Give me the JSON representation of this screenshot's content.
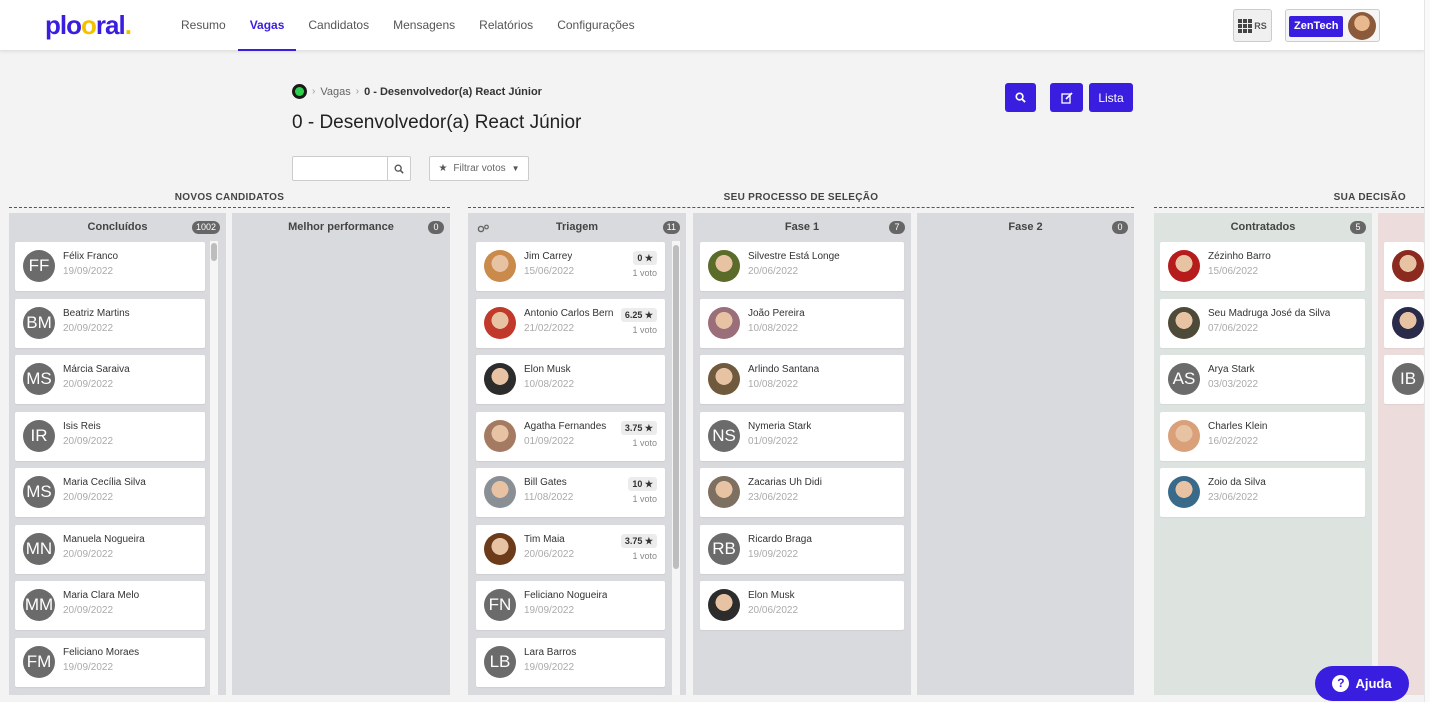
{
  "app": {
    "logo": "plooral",
    "colors": {
      "brand": "#3a1ee0",
      "logo_dot": "#f2c200"
    }
  },
  "nav": {
    "items": [
      "Resumo",
      "Vagas",
      "Candidatos",
      "Mensagens",
      "Relatórios",
      "Configurações"
    ],
    "active": "Vagas"
  },
  "header_right": {
    "apps_label": "RS",
    "company": "ZenTech"
  },
  "breadcrumb": {
    "items": [
      "Vagas",
      "0 - Desenvolvedor(a) React Júnior"
    ]
  },
  "page_title": "0 - Desenvolvedor(a) React Júnior",
  "actions": {
    "search_icon": "search-icon",
    "edit_icon": "edit-icon",
    "list_label": "Lista"
  },
  "filters": {
    "search_value": "",
    "search_placeholder": "",
    "filter_votes_label": "Filtrar votos"
  },
  "sections": {
    "novos": "NOVOS CANDIDATOS",
    "processo": "SEU PROCESSO DE SELEÇÃO",
    "decisao": "SUA DECISÃO"
  },
  "columns": [
    {
      "title": "Concluídos",
      "count": "1002",
      "cards": [
        {
          "name": "Félix Franco",
          "date": "19/09/2022",
          "initials": "FF"
        },
        {
          "name": "Beatriz Martins",
          "date": "20/09/2022",
          "initials": "BM"
        },
        {
          "name": "Márcia Saraiva",
          "date": "20/09/2022",
          "initials": "MS"
        },
        {
          "name": "Isis Reis",
          "date": "20/09/2022",
          "initials": "IR"
        },
        {
          "name": "Maria Cecília Silva",
          "date": "20/09/2022",
          "initials": "MS"
        },
        {
          "name": "Manuela Nogueira",
          "date": "20/09/2022",
          "initials": "MN"
        },
        {
          "name": "Maria Clara Melo",
          "date": "20/09/2022",
          "initials": "MM"
        },
        {
          "name": "Feliciano Moraes",
          "date": "19/09/2022",
          "initials": "FM"
        }
      ]
    },
    {
      "title": "Melhor performance",
      "count": "0",
      "cards": []
    },
    {
      "title": "Triagem",
      "count": "11",
      "cards": [
        {
          "name": "Jim Carrey",
          "date": "15/06/2022",
          "score": "0",
          "votes": "1 voto",
          "photo": "#c98a4b"
        },
        {
          "name": "Antonio Carlos Bern",
          "date": "21/02/2022",
          "score": "6.25",
          "votes": "1 voto",
          "photo": "#c0392b"
        },
        {
          "name": "Elon Musk",
          "date": "10/08/2022",
          "photo": "#2c2c2c"
        },
        {
          "name": "Agatha Fernandes",
          "date": "01/09/2022",
          "score": "3.75",
          "votes": "1 voto",
          "photo": "#a57a62"
        },
        {
          "name": "Bill Gates",
          "date": "11/08/2022",
          "score": "10",
          "votes": "1 voto",
          "photo": "#8a8f96"
        },
        {
          "name": "Tim Maia",
          "date": "20/06/2022",
          "score": "3.75",
          "votes": "1 voto",
          "photo": "#6b3b1a"
        },
        {
          "name": "Feliciano Nogueira",
          "date": "19/09/2022",
          "initials": "FN"
        },
        {
          "name": "Lara Barros",
          "date": "19/09/2022",
          "initials": "LB"
        }
      ]
    },
    {
      "title": "Fase 1",
      "count": "7",
      "cards": [
        {
          "name": "Silvestre Está Longe",
          "date": "20/06/2022",
          "photo": "#5a6b2a"
        },
        {
          "name": "João Pereira",
          "date": "10/08/2022",
          "photo": "#9b6f7a"
        },
        {
          "name": "Arlindo Santana",
          "date": "10/08/2022",
          "photo": "#6f5a3e"
        },
        {
          "name": "Nymeria Stark",
          "date": "01/09/2022",
          "initials": "NS"
        },
        {
          "name": "Zacarias Uh Didi",
          "date": "23/06/2022",
          "photo": "#7d7060"
        },
        {
          "name": "Ricardo Braga",
          "date": "19/09/2022",
          "initials": "RB"
        },
        {
          "name": "Elon Musk",
          "date": "20/06/2022",
          "photo": "#2c2c2c"
        }
      ]
    },
    {
      "title": "Fase 2",
      "count": "0",
      "cards": []
    },
    {
      "title": "Contratados",
      "count": "5",
      "cards": [
        {
          "name": "Zézinho Barro",
          "date": "15/06/2022",
          "photo": "#b71c1c"
        },
        {
          "name": "Seu Madruga José da Silva",
          "date": "07/06/2022",
          "photo": "#4e4a3a"
        },
        {
          "name": "Arya Stark",
          "date": "03/03/2022",
          "initials": "AS"
        },
        {
          "name": "Charles Klein",
          "date": "16/02/2022",
          "photo": "#d9a07a"
        },
        {
          "name": "Zoio da Silva",
          "date": "23/06/2022",
          "photo": "#3a6a8a"
        }
      ]
    },
    {
      "title": "",
      "count": "",
      "cards": [
        {
          "photo": "#8b2a1f"
        },
        {
          "photo": "#2a2a4a"
        },
        {
          "initials": "IB"
        }
      ]
    }
  ],
  "help": {
    "label": "Ajuda"
  }
}
